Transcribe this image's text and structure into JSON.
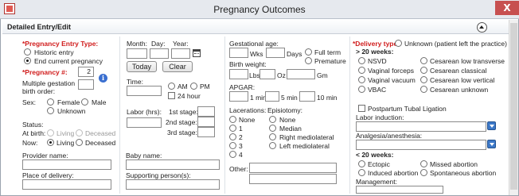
{
  "window": {
    "title": "Pregnancy Outcomes",
    "close": "X"
  },
  "section": {
    "title": "Detailed Entry/Edit"
  },
  "entry": {
    "type_label": "*Pregnancy Entry Type:",
    "historic": "Historic entry",
    "end_current": "End current pregnancy",
    "number_label": "*Pregnancy #:",
    "number_value": "2",
    "multiple_line1": "Multiple gestation",
    "multiple_line2": "birth order:",
    "info": "i",
    "sex_label": "Sex:",
    "female": "Female",
    "male": "Male",
    "unknown": "Unknown",
    "status_label": "Status:",
    "at_birth": "At birth:",
    "now": "Now:",
    "living": "Living",
    "deceased": "Deceased"
  },
  "datetime": {
    "month": "Month:",
    "day": "Day:",
    "year": "Year:",
    "today": "Today",
    "clear": "Clear",
    "time_label": "Time:",
    "am": "AM",
    "pm": "PM",
    "h24": "24 hour",
    "labor_label": "Labor (hrs):",
    "stage1": "1st stage:",
    "stage2": "2nd stage:",
    "stage3": "3rd stage:"
  },
  "measures": {
    "gest_label": "Gestational age:",
    "wks": "Wks",
    "days": "Days",
    "full_term": "Full term",
    "premature": "Premature",
    "weight_label": "Birth weight:",
    "lbs": "Lbs",
    "oz": "Oz",
    "gm": "Gm",
    "apgar_label": "APGAR:",
    "min1": "1 min",
    "min5": "5 min",
    "min10": "10 min",
    "lacerations_label": "Lacerations:",
    "lac_none": "None",
    "lac1": "1",
    "lac2": "2",
    "lac3": "3",
    "lac4": "4",
    "episiotomy_label": "Episiotomy:",
    "epi_none": "None",
    "median": "Median",
    "right_ml": "Right mediolateral",
    "left_ml": "Left mediolateral",
    "other_label": "Other:"
  },
  "delivery": {
    "type_label": "*Delivery type:",
    "unknown_left": "Unknown (patient left the practice)",
    "over20": "> 20 weeks:",
    "nsvd": "NSVD",
    "vag_forceps": "Vaginal forceps",
    "vag_vacuum": "Vaginal vacuum",
    "vbac": "VBAC",
    "ces_low_trans": "Cesarean low transverse",
    "ces_classical": "Cesarean classical",
    "ces_low_vert": "Cesarean low vertical",
    "ces_unknown": "Cesarean unknown",
    "tubal": "Postpartum Tubal Ligation",
    "induction_label": "Labor induction:",
    "analgesia_label": "Analgesia/anesthesia:",
    "under20": "< 20 weeks:",
    "ectopic": "Ectopic",
    "missed": "Missed abortion",
    "induced": "Induced abortion",
    "spontaneous": "Spontaneous abortion",
    "management_label": "Management:"
  },
  "bottom": {
    "provider": "Provider name:",
    "place": "Place of delivery:",
    "baby": "Baby name:",
    "support": "Supporting person(s):"
  }
}
